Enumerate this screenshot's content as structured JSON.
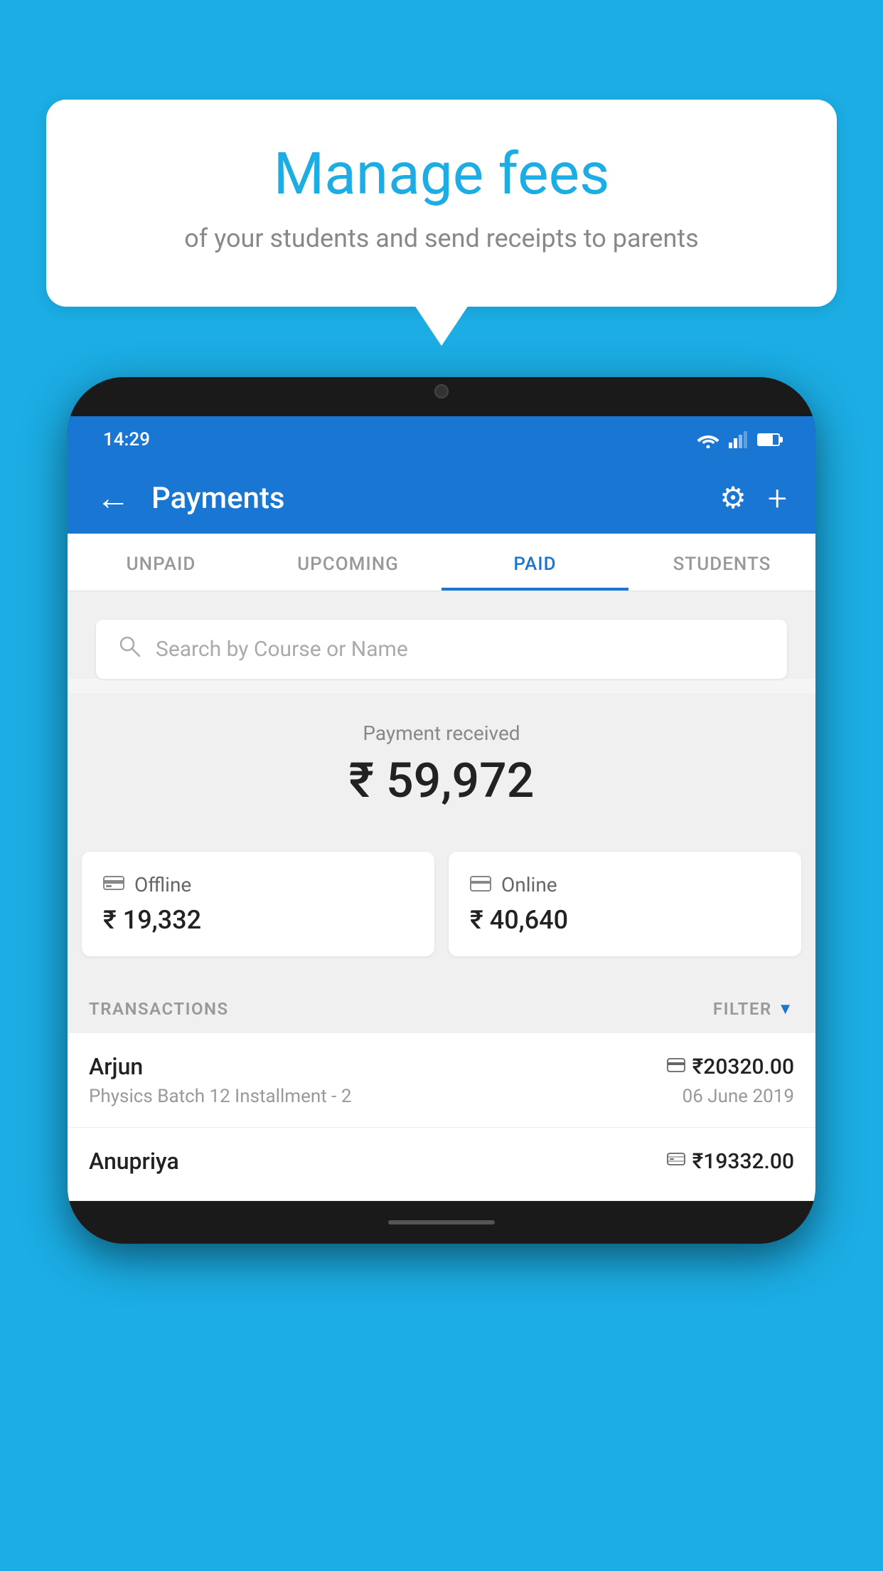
{
  "bubble": {
    "title": "Manage fees",
    "subtitle": "of your students and send receipts to parents"
  },
  "statusBar": {
    "time": "14:29"
  },
  "header": {
    "title": "Payments",
    "back_label": "←",
    "settings_label": "⚙",
    "plus_label": "+"
  },
  "tabs": [
    {
      "label": "UNPAID",
      "active": false
    },
    {
      "label": "UPCOMING",
      "active": false
    },
    {
      "label": "PAID",
      "active": true
    },
    {
      "label": "STUDENTS",
      "active": false
    }
  ],
  "search": {
    "placeholder": "Search by Course or Name"
  },
  "paymentSummary": {
    "label": "Payment received",
    "amount": "₹ 59,972",
    "offline": {
      "label": "Offline",
      "amount": "₹ 19,332"
    },
    "online": {
      "label": "Online",
      "amount": "₹ 40,640"
    }
  },
  "transactions": {
    "header": "TRANSACTIONS",
    "filter": "FILTER",
    "items": [
      {
        "name": "Arjun",
        "description": "Physics Batch 12 Installment - 2",
        "amount": "₹20320.00",
        "date": "06 June 2019",
        "icon_type": "card"
      },
      {
        "name": "Anupriya",
        "description": "",
        "amount": "₹19332.00",
        "date": "",
        "icon_type": "cash"
      }
    ]
  }
}
